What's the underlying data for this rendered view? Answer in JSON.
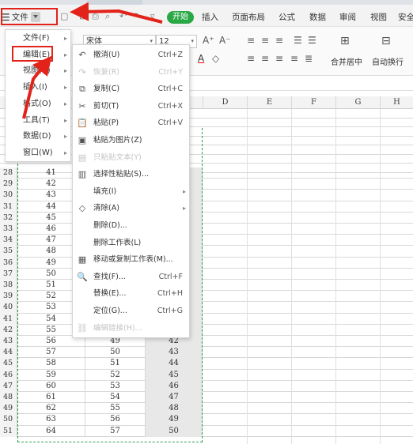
{
  "menubar": {
    "file_label": "文件",
    "start_tab": "开始",
    "tabs": [
      "插入",
      "页面布局",
      "公式",
      "数据",
      "审阅",
      "视图",
      "安全"
    ]
  },
  "ribbon": {
    "font_name": "宋体",
    "font_size": "12",
    "merge_center": "合并居中",
    "wrap_text": "自动换行",
    "grow_font": "A⁺",
    "shrink_font": "A⁻"
  },
  "columns": [
    "D",
    "E",
    "F",
    "G",
    "H"
  ],
  "file_menu": [
    {
      "label": "文件(F)",
      "has_sub": true
    },
    {
      "label": "编辑(E)",
      "has_sub": true
    },
    {
      "label": "视图(V)",
      "has_sub": true
    },
    {
      "label": "插入(I)",
      "has_sub": true
    },
    {
      "label": "格式(O)",
      "has_sub": true
    },
    {
      "label": "工具(T)",
      "has_sub": true
    },
    {
      "label": "数据(D)",
      "has_sub": true
    },
    {
      "label": "窗口(W)",
      "has_sub": true
    }
  ],
  "edit_menu": [
    {
      "icon": "undo-icon",
      "glyph": "↶",
      "label": "撤消(U)",
      "shortcut": "Ctrl+Z",
      "disabled": false
    },
    {
      "icon": "redo-icon",
      "glyph": "↷",
      "label": "恢复(R)",
      "shortcut": "Ctrl+Y",
      "disabled": true
    },
    {
      "icon": "copy-icon",
      "glyph": "⧉",
      "label": "复制(C)",
      "shortcut": "Ctrl+C",
      "disabled": false
    },
    {
      "icon": "cut-icon",
      "glyph": "✂",
      "label": "剪切(T)",
      "shortcut": "Ctrl+X",
      "disabled": false
    },
    {
      "icon": "paste-icon",
      "glyph": "📋",
      "label": "粘贴(P)",
      "shortcut": "Ctrl+V",
      "disabled": false
    },
    {
      "icon": "paste-as-image-icon",
      "glyph": "▣",
      "label": "粘贴为图片(Z)",
      "shortcut": "",
      "disabled": false
    },
    {
      "icon": "paste-text-icon",
      "glyph": "▤",
      "label": "只粘贴文本(Y)",
      "shortcut": "",
      "disabled": true
    },
    {
      "icon": "paste-special-icon",
      "glyph": "▥",
      "label": "选择性粘贴(S)...",
      "shortcut": "",
      "disabled": false
    },
    {
      "icon": "",
      "glyph": "",
      "label": "填充(I)",
      "shortcut": "",
      "disabled": false,
      "has_sub": true
    },
    {
      "icon": "clear-icon",
      "glyph": "◇",
      "label": "清除(A)",
      "shortcut": "",
      "disabled": false,
      "has_sub": true
    },
    {
      "icon": "",
      "glyph": "",
      "label": "删除(D)...",
      "shortcut": "",
      "disabled": false
    },
    {
      "icon": "",
      "glyph": "",
      "label": "删除工作表(L)",
      "shortcut": "",
      "disabled": false
    },
    {
      "icon": "move-sheet-icon",
      "glyph": "▦",
      "label": "移动或复制工作表(M)...",
      "shortcut": "",
      "disabled": false
    },
    {
      "icon": "find-icon",
      "glyph": "🔍",
      "label": "查找(F)...",
      "shortcut": "Ctrl+F",
      "disabled": false
    },
    {
      "icon": "",
      "glyph": "",
      "label": "替换(E)...",
      "shortcut": "Ctrl+H",
      "disabled": false
    },
    {
      "icon": "",
      "glyph": "",
      "label": "定位(G)...",
      "shortcut": "Ctrl+G",
      "disabled": false
    },
    {
      "icon": "edit-links-icon",
      "glyph": "⛓",
      "label": "编辑链接(H)...",
      "shortcut": "",
      "disabled": true
    }
  ],
  "rows": [
    {
      "n": "28",
      "a": "41",
      "b": "",
      "c": ""
    },
    {
      "n": "29",
      "a": "42",
      "b": "",
      "c": ""
    },
    {
      "n": "30",
      "a": "43",
      "b": "",
      "c": ""
    },
    {
      "n": "31",
      "a": "44",
      "b": "",
      "c": ""
    },
    {
      "n": "32",
      "a": "45",
      "b": "",
      "c": ""
    },
    {
      "n": "33",
      "a": "46",
      "b": "",
      "c": ""
    },
    {
      "n": "34",
      "a": "47",
      "b": "",
      "c": ""
    },
    {
      "n": "35",
      "a": "48",
      "b": "",
      "c": ""
    },
    {
      "n": "36",
      "a": "49",
      "b": "",
      "c": ""
    },
    {
      "n": "37",
      "a": "50",
      "b": "",
      "c": ""
    },
    {
      "n": "38",
      "a": "51",
      "b": "",
      "c": ""
    },
    {
      "n": "39",
      "a": "52",
      "b": "",
      "c": ""
    },
    {
      "n": "40",
      "a": "53",
      "b": "",
      "c": ""
    },
    {
      "n": "41",
      "a": "54",
      "b": "",
      "c": ""
    },
    {
      "n": "42",
      "a": "55",
      "b": "",
      "c": ""
    },
    {
      "n": "43",
      "a": "56",
      "b": "49",
      "c": "42"
    },
    {
      "n": "44",
      "a": "57",
      "b": "50",
      "c": "43"
    },
    {
      "n": "45",
      "a": "58",
      "b": "51",
      "c": "44"
    },
    {
      "n": "46",
      "a": "59",
      "b": "52",
      "c": "45"
    },
    {
      "n": "47",
      "a": "60",
      "b": "53",
      "c": "46"
    },
    {
      "n": "48",
      "a": "61",
      "b": "54",
      "c": "47"
    },
    {
      "n": "49",
      "a": "62",
      "b": "55",
      "c": "48"
    },
    {
      "n": "50",
      "a": "63",
      "b": "56",
      "c": "49"
    },
    {
      "n": "51",
      "a": "64",
      "b": "57",
      "c": "50"
    }
  ],
  "colors": {
    "highlight": "#e2231a",
    "accent_green": "#2aa845",
    "marquee": "#2f9a4c"
  }
}
